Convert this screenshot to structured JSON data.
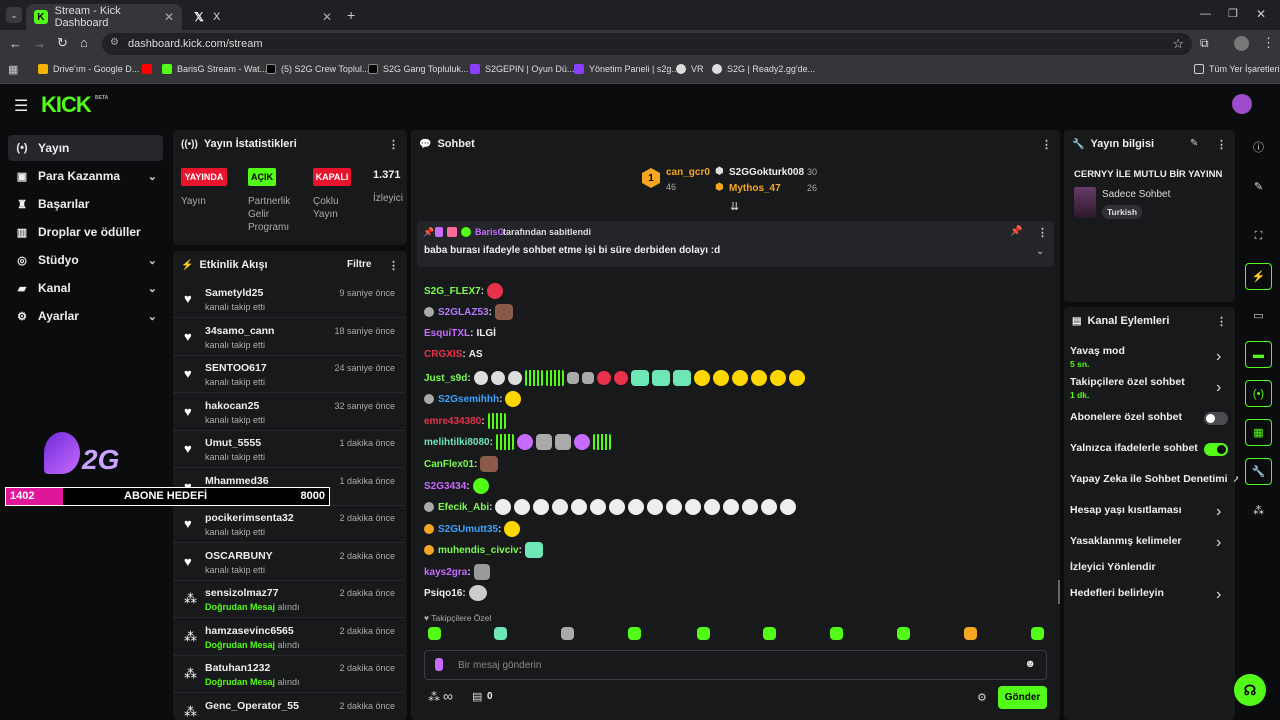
{
  "browser": {
    "tabs": [
      {
        "title": "Stream - Kick Dashboard",
        "icon": "kick-icon"
      },
      {
        "title": "X",
        "icon": "x-logo-icon"
      }
    ],
    "url": "dashboard.kick.com/stream",
    "bookmarks": [
      "Drive'ım - Google D...",
      "BarisG Stream - Wat...",
      "(5) S2G Crew Toplul...",
      "S2G Gang Topluluk...",
      "S2GEPIN | Oyun Dü...",
      "Yönetim Paneli | s2g...",
      "VR",
      "S2G | Ready2.gg'de..."
    ],
    "all_bookmarks": "Tüm Yer İşaretleri"
  },
  "brand": {
    "logo": "KICK",
    "beta": "BETA"
  },
  "sidebar": {
    "items": [
      {
        "label": "Yayın",
        "icon": "broadcast-icon"
      },
      {
        "label": "Para Kazanma",
        "icon": "money-icon"
      },
      {
        "label": "Başarılar",
        "icon": "trophy-icon"
      },
      {
        "label": "Droplar ve ödüller",
        "icon": "gift-icon"
      },
      {
        "label": "Stüdyo",
        "icon": "studio-icon"
      },
      {
        "label": "Kanal",
        "icon": "channel-icon"
      },
      {
        "label": "Ayarlar",
        "icon": "gear-icon"
      }
    ]
  },
  "overlay": {
    "logo_text": "2G",
    "goal_current": "1402",
    "goal_label": "ABONE HEDEFİ",
    "goal_target": "8000",
    "goal_progress": 0.175
  },
  "stats": {
    "title": "Yayın İstatistikleri",
    "badges": [
      "YAYINDA",
      "AÇIK",
      "KAPALI"
    ],
    "viewers": "1.371",
    "labels": [
      "Yayın",
      "Partnerlik Gelir Programı",
      "Çoklu Yayın",
      "İzleyici"
    ]
  },
  "activity": {
    "title": "Etkinlik Akışı",
    "filter": "Filtre",
    "items": [
      {
        "name": "Sametyld25",
        "desc": "kanalı takip etti",
        "time": "9 saniye önce",
        "type": "follow"
      },
      {
        "name": "34samo_cann",
        "desc": "kanalı takip etti",
        "time": "18 saniye önce",
        "type": "follow"
      },
      {
        "name": "SENTOO617",
        "desc": "kanalı takip etti",
        "time": "24 saniye önce",
        "type": "follow"
      },
      {
        "name": "hakocan25",
        "desc": "kanalı takip etti",
        "time": "32 saniye önce",
        "type": "follow"
      },
      {
        "name": "Umut_5555",
        "desc": "kanalı takip etti",
        "time": "1 dakika önce",
        "type": "follow"
      },
      {
        "name": "Mhammed36",
        "desc": "kanalı takip etti",
        "time": "1 dakika önce",
        "type": "follow"
      },
      {
        "name": "pocikerimsenta32",
        "desc": "kanalı takip etti",
        "time": "2 dakika önce",
        "type": "follow"
      },
      {
        "name": "OSCARBUNY",
        "desc": "kanalı takip etti",
        "time": "2 dakika önce",
        "type": "follow"
      },
      {
        "name": "sensizolmaz77",
        "desc_hl": "Doğrudan Mesaj",
        "desc": "alındı",
        "time": "2 dakika önce",
        "type": "dm"
      },
      {
        "name": "hamzasevinc6565",
        "desc_hl": "Doğrudan Mesaj",
        "desc": "alındı",
        "time": "2 dakika önce",
        "type": "dm"
      },
      {
        "name": "Batuhan1232",
        "desc_hl": "Doğrudan Mesaj",
        "desc": "alındı",
        "time": "2 dakika önce",
        "type": "dm"
      },
      {
        "name": "Genc_Operator_55",
        "desc": "",
        "time": "2 dakika önce",
        "type": "dm"
      }
    ]
  },
  "chat": {
    "title": "Sohbet",
    "top": [
      {
        "name": "can_gcr0",
        "count": "46",
        "rank": "1"
      },
      {
        "name": "S2GGokturk008",
        "count": "30"
      },
      {
        "name": "Mythos_47",
        "count": "26"
      }
    ],
    "pinned_by": "BarisG",
    "pinned_suffix": "tarafından sabitlendi",
    "pinned_text": "baba burası ifadeyle sohbet etme işi bi süre derbiden dolayı :d",
    "messages": [
      {
        "user": "S2G_FLEX7",
        "color": "#7dfc4f",
        "text": ""
      },
      {
        "user": "S2GLAZ53",
        "color": "#b37bff",
        "text": ""
      },
      {
        "user": "EsquiTXL",
        "color": "#c86bff",
        "text": "ILGİ"
      },
      {
        "user": "CRGXIS",
        "color": "#e8324b",
        "text": "AS"
      },
      {
        "user": "Just_s9d",
        "color": "#7dfc4f",
        "text": ""
      },
      {
        "user": "S2Gsemihhh",
        "color": "#3ba3ff",
        "text": ""
      },
      {
        "user": "emre434380",
        "color": "#e8324b",
        "text": ""
      },
      {
        "user": "melihtilki8080",
        "color": "#6ee7b7",
        "text": ""
      },
      {
        "user": "CanFlex01",
        "color": "#7dfc4f",
        "text": ""
      },
      {
        "user": "S2G3434",
        "color": "#c86bff",
        "text": ""
      },
      {
        "user": "Efecik_Abi",
        "color": "#7dfc4f",
        "text": ""
      },
      {
        "user": "S2GUmutt35",
        "color": "#3ba3ff",
        "text": ""
      },
      {
        "user": "muhendis_civciv",
        "color": "#7dfc4f",
        "text": ""
      },
      {
        "user": "kays2gra",
        "color": "#c86bff",
        "text": ""
      },
      {
        "user": "Psiqo16",
        "color": "#eeeeee",
        "text": ""
      }
    ],
    "follower_label": "Takipçilere Özel",
    "input_placeholder": "Bir mesaj gönderin",
    "infinity": "∞",
    "gift_count": "0",
    "send": "Gönder"
  },
  "stream_info": {
    "title": "Yayın bilgisi",
    "stream_title": "CERNYY İLE MUTLU BİR YAYINN",
    "category": "Sadece Sohbet",
    "tag": "Turkish"
  },
  "channel_actions": {
    "title": "Kanal Eylemleri",
    "items": [
      {
        "label": "Yavaş mod",
        "sub": "5 sn.",
        "control": "chevron"
      },
      {
        "label": "Takipçilere özel sohbet",
        "sub": "1 dk.",
        "control": "chevron"
      },
      {
        "label": "Abonelere özel sohbet",
        "sub": "",
        "control": "toggle-off"
      },
      {
        "label": "Yalnızca ifadelerle sohbet",
        "sub": "",
        "control": "toggle-on"
      },
      {
        "label": "Yapay Zeka ile Sohbet Denetimi",
        "sub": "",
        "control": "external"
      },
      {
        "label": "Hesap yaşı kısıtlaması",
        "sub": "",
        "control": "chevron"
      },
      {
        "label": "Yasaklanmış kelimeler",
        "sub": "",
        "control": "chevron"
      },
      {
        "label": "İzleyici Yönlendir",
        "sub": "",
        "control": "none"
      },
      {
        "label": "Hedefleri belirleyin",
        "sub": "",
        "control": "chevron"
      }
    ]
  },
  "colors": {
    "accent": "#53fc18",
    "live_red": "#e8142d",
    "goal_pink": "#e0169a"
  }
}
